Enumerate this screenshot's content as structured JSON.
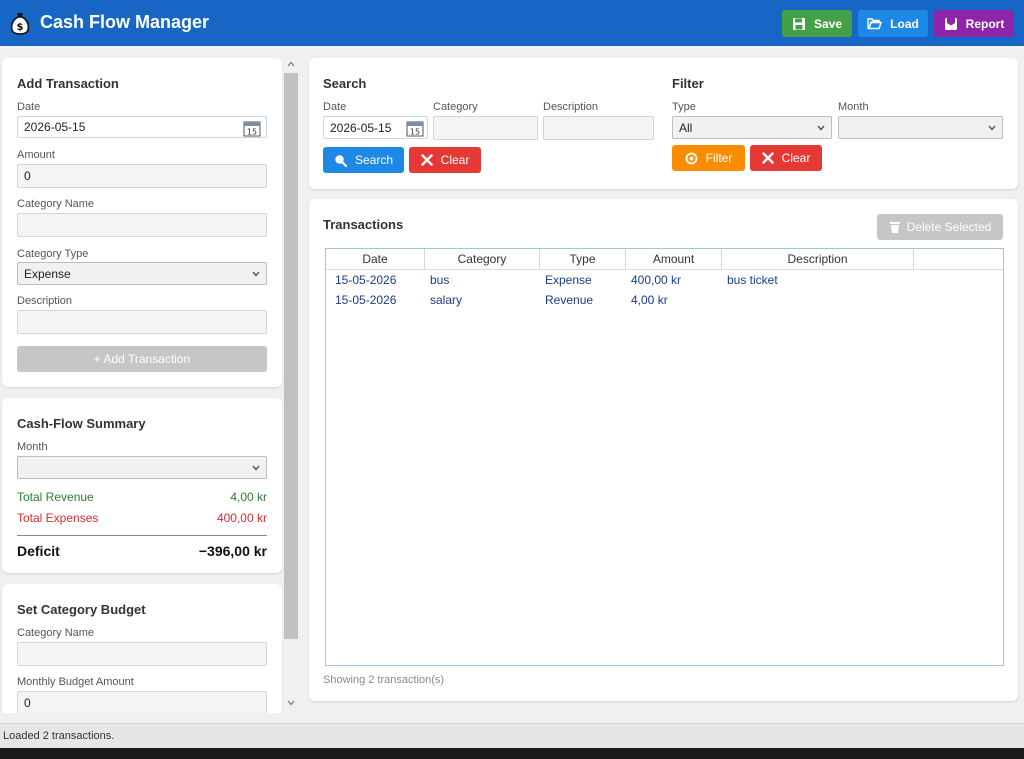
{
  "app": {
    "title": "Cash Flow Manager"
  },
  "header": {
    "save_label": "Save",
    "load_label": "Load",
    "report_label": "Report"
  },
  "add_transaction": {
    "title": "Add Transaction",
    "date_label": "Date",
    "date_value": "2026-05-15",
    "amount_label": "Amount",
    "amount_value": "0",
    "category_name_label": "Category Name",
    "category_name_value": "",
    "category_type_label": "Category Type",
    "category_type_value": "Expense",
    "description_label": "Description",
    "description_value": "",
    "add_button_label": "+   Add Transaction"
  },
  "summary": {
    "title": "Cash-Flow Summary",
    "month_label": "Month",
    "month_value": "",
    "total_revenue_label": "Total Revenue",
    "total_revenue_value": "4,00 kr",
    "total_expenses_label": "Total Expenses",
    "total_expenses_value": "400,00 kr",
    "deficit_label": "Deficit",
    "deficit_value": "−396,00 kr"
  },
  "budget": {
    "title": "Set Category Budget",
    "category_name_label": "Category Name",
    "category_name_value": "",
    "monthly_budget_label": "Monthly Budget Amount",
    "monthly_budget_value": "0"
  },
  "search": {
    "title": "Search",
    "date_label": "Date",
    "date_value": "2026-05-15",
    "category_label": "Category",
    "category_value": "",
    "description_label": "Description",
    "description_value": "",
    "search_button_label": "Search",
    "clear_button_label": "Clear"
  },
  "filter": {
    "title": "Filter",
    "type_label": "Type",
    "type_value": "All",
    "month_label": "Month",
    "month_value": "",
    "filter_button_label": "Filter",
    "clear_button_label": "Clear"
  },
  "transactions": {
    "title": "Transactions",
    "delete_button_label": "Delete Selected",
    "columns": [
      "Date",
      "Category",
      "Type",
      "Amount",
      "Description"
    ],
    "rows": [
      {
        "date": "15-05-2026",
        "category": "bus",
        "type": "Expense",
        "amount": "400,00 kr",
        "description": "bus ticket"
      },
      {
        "date": "15-05-2026",
        "category": "salary",
        "type": "Revenue",
        "amount": "4,00 kr",
        "description": ""
      }
    ],
    "footer": "Showing 2 transaction(s)"
  },
  "status_bar": {
    "text": "Loaded 2 transactions."
  },
  "colors": {
    "header": "#1766c5",
    "save": "#43a047",
    "load": "#1e88e5",
    "report": "#8e24aa",
    "revenue": "#2e7d32",
    "expense": "#d32f2f",
    "filter": "#fb8c00",
    "clear": "#e53935"
  },
  "icons": {
    "app": "money-bag-icon",
    "save": "floppy-disk-icon",
    "load": "folder-open-icon",
    "report": "report-icon",
    "calendar": "calendar-icon",
    "search": "search-icon",
    "clear": "close-icon",
    "filter": "filter-icon",
    "delete": "trash-icon"
  }
}
